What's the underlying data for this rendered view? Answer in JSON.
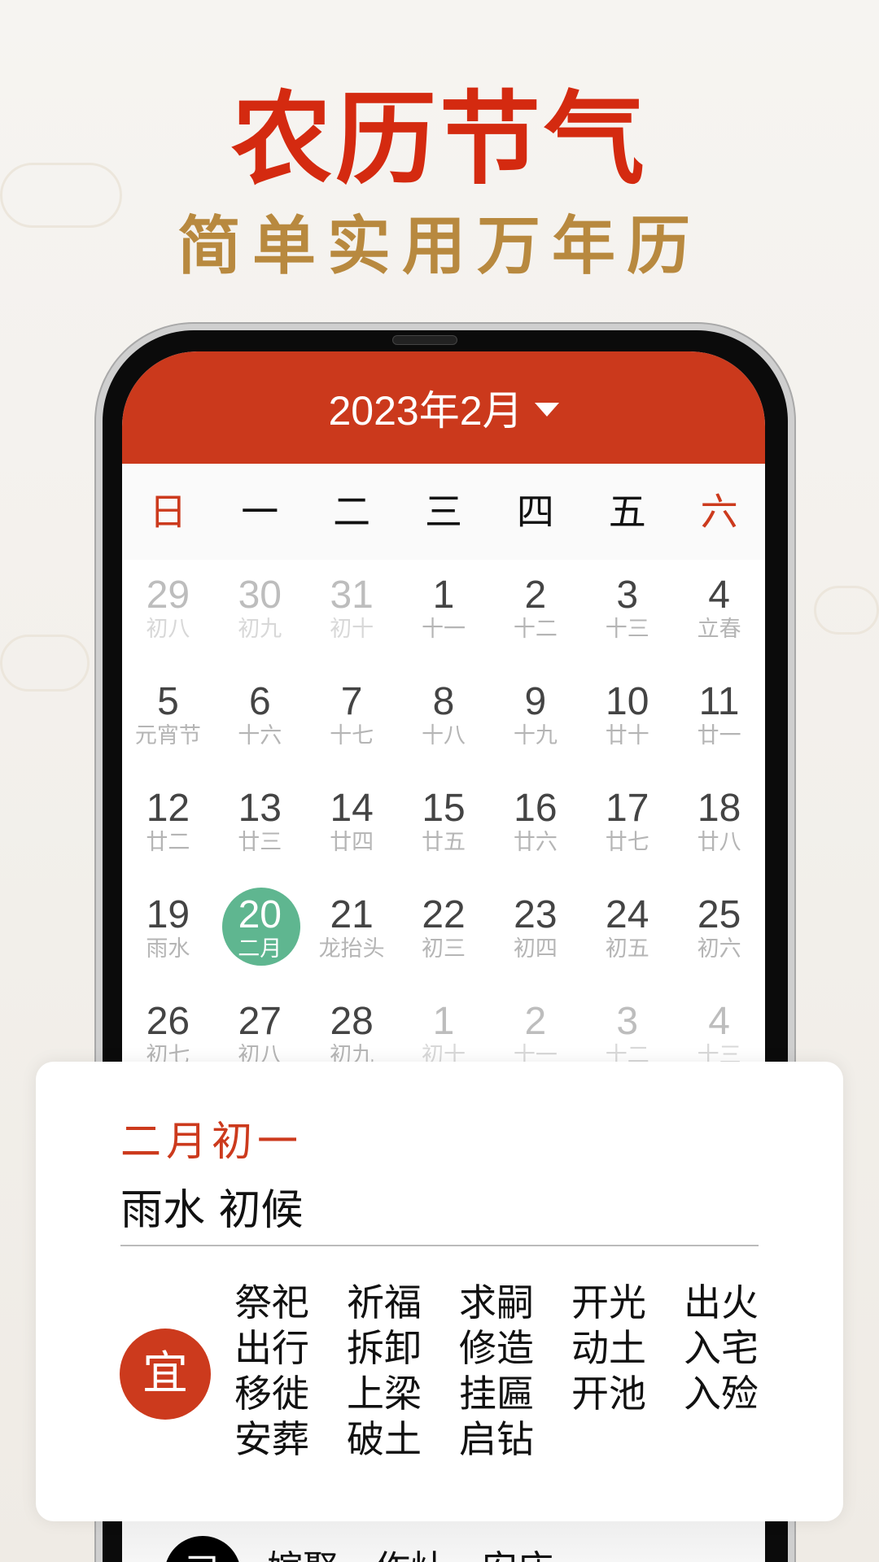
{
  "hero": {
    "title": "农历节气",
    "subtitle": "简单实用万年历"
  },
  "calendar": {
    "month_label": "2023年2月",
    "weekdays": [
      "日",
      "一",
      "二",
      "三",
      "四",
      "五",
      "六"
    ],
    "rows": [
      [
        {
          "d": "29",
          "l": "初八",
          "muted": true
        },
        {
          "d": "30",
          "l": "初九",
          "muted": true
        },
        {
          "d": "31",
          "l": "初十",
          "muted": true
        },
        {
          "d": "1",
          "l": "十一"
        },
        {
          "d": "2",
          "l": "十二"
        },
        {
          "d": "3",
          "l": "十三"
        },
        {
          "d": "4",
          "l": "立春"
        }
      ],
      [
        {
          "d": "5",
          "l": "元宵节"
        },
        {
          "d": "6",
          "l": "十六"
        },
        {
          "d": "7",
          "l": "十七"
        },
        {
          "d": "8",
          "l": "十八"
        },
        {
          "d": "9",
          "l": "十九"
        },
        {
          "d": "10",
          "l": "廿十"
        },
        {
          "d": "11",
          "l": "廿一"
        }
      ],
      [
        {
          "d": "12",
          "l": "廿二"
        },
        {
          "d": "13",
          "l": "廿三"
        },
        {
          "d": "14",
          "l": "廿四"
        },
        {
          "d": "15",
          "l": "廿五"
        },
        {
          "d": "16",
          "l": "廿六"
        },
        {
          "d": "17",
          "l": "廿七"
        },
        {
          "d": "18",
          "l": "廿八"
        }
      ],
      [
        {
          "d": "19",
          "l": "雨水"
        },
        {
          "d": "20",
          "l": "二月",
          "selected": true
        },
        {
          "d": "21",
          "l": "龙抬头"
        },
        {
          "d": "22",
          "l": "初三"
        },
        {
          "d": "23",
          "l": "初四"
        },
        {
          "d": "24",
          "l": "初五"
        },
        {
          "d": "25",
          "l": "初六"
        }
      ],
      [
        {
          "d": "26",
          "l": "初七"
        },
        {
          "d": "27",
          "l": "初八"
        },
        {
          "d": "28",
          "l": "初九"
        },
        {
          "d": "1",
          "l": "初十",
          "muted": true
        },
        {
          "d": "2",
          "l": "十一",
          "muted": true
        },
        {
          "d": "3",
          "l": "十二",
          "muted": true
        },
        {
          "d": "4",
          "l": "十三",
          "muted": true
        }
      ]
    ]
  },
  "detail": {
    "lunar_date": "二月初一",
    "solar_term": "雨水 初候",
    "yi_label": "宜",
    "yi_items": [
      "祭祀",
      "祈福",
      "求嗣",
      "开光",
      "出火",
      "出行",
      "拆卸",
      "修造",
      "动土",
      "入宅",
      "移徙",
      "上梁",
      "挂匾",
      "开池",
      "入殓",
      "安葬",
      "破土",
      "启钻"
    ],
    "ji_label": "忌",
    "ji_items": "嫁娶 作灶 安床"
  },
  "colors": {
    "accent": "#cb391c",
    "selected": "#5fb690",
    "title": "#d42a10",
    "subtitle": "#b8893f"
  }
}
